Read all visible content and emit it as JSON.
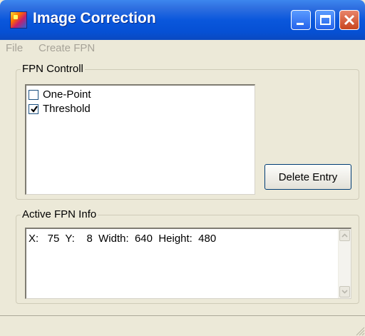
{
  "window": {
    "title": "Image Correction"
  },
  "menu": {
    "items": [
      {
        "label": "File",
        "enabled": false
      },
      {
        "label": "Create FPN",
        "enabled": false
      }
    ]
  },
  "fpn_control": {
    "label": "FPN Controll",
    "items": [
      {
        "label": "One-Point",
        "checked": false
      },
      {
        "label": "Threshold",
        "checked": true
      }
    ],
    "delete_label": "Delete Entry"
  },
  "active_info": {
    "label": "Active FPN Info",
    "text": "X:   75  Y:    8  Width:  640  Height:  480"
  },
  "colors": {
    "titlebar": "#0a57dc",
    "window_bg": "#ece9d8",
    "close_button": "#c8451e",
    "menu_disabled_text": "#a7a398"
  }
}
